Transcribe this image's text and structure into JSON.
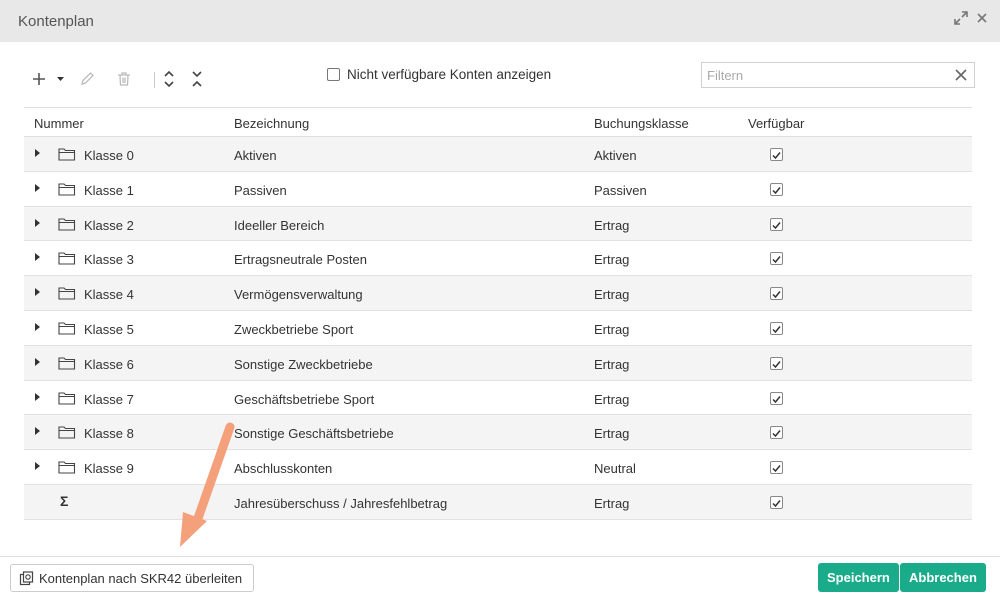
{
  "window": {
    "title": "Kontenplan",
    "expand_icon": "expand-icon",
    "close_icon": "close-icon"
  },
  "toolbar": {
    "add_icon": "plus-icon",
    "edit_icon": "pencil-icon",
    "delete_icon": "trash-icon",
    "expand_all_icon": "chevrons-expand-icon",
    "collapse_all_icon": "chevrons-collapse-icon",
    "show_unavailable_label": "Nicht verfügbare Konten anzeigen",
    "show_unavailable_checked": false,
    "filter_placeholder": "Filtern",
    "filter_value": ""
  },
  "grid": {
    "columns": [
      "Nummer",
      "Bezeichnung",
      "Buchungsklasse",
      "Verfügbar"
    ],
    "rows": [
      {
        "nummer": "Klasse 0",
        "bezeichnung": "Aktiven",
        "buchungsklasse": "Aktiven",
        "verfuegbar": true,
        "type": "folder"
      },
      {
        "nummer": "Klasse 1",
        "bezeichnung": "Passiven",
        "buchungsklasse": "Passiven",
        "verfuegbar": true,
        "type": "folder"
      },
      {
        "nummer": "Klasse 2",
        "bezeichnung": "Ideeller Bereich",
        "buchungsklasse": "Ertrag",
        "verfuegbar": true,
        "type": "folder"
      },
      {
        "nummer": "Klasse 3",
        "bezeichnung": "Ertragsneutrale Posten",
        "buchungsklasse": "Ertrag",
        "verfuegbar": true,
        "type": "folder"
      },
      {
        "nummer": "Klasse 4",
        "bezeichnung": "Vermögensverwaltung",
        "buchungsklasse": "Ertrag",
        "verfuegbar": true,
        "type": "folder"
      },
      {
        "nummer": "Klasse 5",
        "bezeichnung": "Zweckbetriebe Sport",
        "buchungsklasse": "Ertrag",
        "verfuegbar": true,
        "type": "folder"
      },
      {
        "nummer": "Klasse 6",
        "bezeichnung": "Sonstige Zweckbetriebe",
        "buchungsklasse": "Ertrag",
        "verfuegbar": true,
        "type": "folder"
      },
      {
        "nummer": "Klasse 7",
        "bezeichnung": "Geschäftsbetriebe Sport",
        "buchungsklasse": "Ertrag",
        "verfuegbar": true,
        "type": "folder"
      },
      {
        "nummer": "Klasse 8",
        "bezeichnung": "Sonstige Geschäftsbetriebe",
        "buchungsklasse": "Ertrag",
        "verfuegbar": true,
        "type": "folder"
      },
      {
        "nummer": "Klasse 9",
        "bezeichnung": "Abschlusskonten",
        "buchungsklasse": "Neutral",
        "verfuegbar": true,
        "type": "folder"
      },
      {
        "nummer": "",
        "bezeichnung": "Jahresüberschuss / Jahresfehlbetrag",
        "buchungsklasse": "Ertrag",
        "verfuegbar": true,
        "type": "sum"
      }
    ]
  },
  "footer": {
    "migrate_label": "Kontenplan nach SKR42 überleiten",
    "save_label": "Speichern",
    "cancel_label": "Abbrechen",
    "primary_color": "#1aab8a"
  },
  "annotation": {
    "arrow_color": "#f4a07a"
  }
}
